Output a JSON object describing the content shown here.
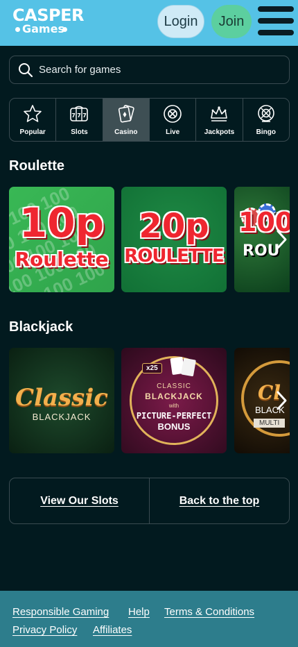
{
  "header": {
    "logo_top": "CASPER",
    "logo_bottom": "Games",
    "login_label": "Login",
    "join_label": "Join",
    "menu_icon": "hamburger-icon",
    "bg_color": "#55c2e6"
  },
  "search": {
    "placeholder": "Search for games",
    "icon": "search-icon"
  },
  "categories": [
    {
      "label": "Popular",
      "icon": "star-icon",
      "active": false
    },
    {
      "label": "Slots",
      "icon": "slot-machine-icon",
      "active": false
    },
    {
      "label": "Casino",
      "icon": "cards-icon",
      "active": true
    },
    {
      "label": "Live",
      "icon": "chip-icon",
      "active": false
    },
    {
      "label": "Jackpots",
      "icon": "crown-icon",
      "active": false
    },
    {
      "label": "Bingo",
      "icon": "bingo-ball-icon",
      "active": false
    }
  ],
  "sections": {
    "roulette": {
      "title": "Roulette",
      "games": [
        {
          "line1": "10p",
          "line2": "Roulette"
        },
        {
          "line1": "20p",
          "line2": "ROULETTE"
        },
        {
          "line1": "100",
          "line2": "ROU"
        }
      ]
    },
    "blackjack": {
      "title": "Blackjack",
      "games": [
        {
          "line1": "Classic",
          "line2": "BLACKJACK"
        },
        {
          "badge": "x25",
          "line1": "CLASSIC",
          "line2": "BLACKJACK",
          "line3": "with",
          "line4": "PICTURE-PERFECT",
          "line5": "BONUS"
        },
        {
          "line1": "Cl",
          "line2": "BLACK",
          "line3": "MULTI"
        }
      ]
    }
  },
  "links": {
    "view_slots": "View Our Slots",
    "back_top": "Back to the top"
  },
  "footer": {
    "responsible": "Responsible Gaming",
    "help": "Help",
    "terms": "Terms & Conditions",
    "privacy": "Privacy Policy",
    "affiliates": "Affiliates",
    "bg_color": "#2d7d8c"
  }
}
